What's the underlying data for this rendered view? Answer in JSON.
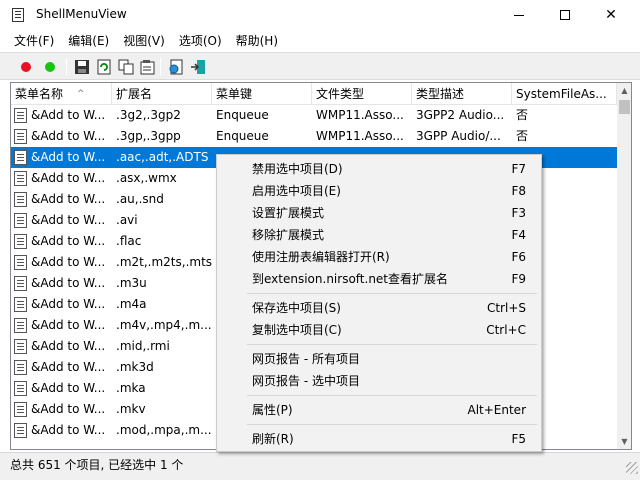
{
  "window": {
    "title": "ShellMenuView"
  },
  "menubar": [
    "文件(F)",
    "编辑(E)",
    "视图(V)",
    "选项(O)",
    "帮助(H)"
  ],
  "toolbar": {
    "colors": {
      "red": "#e81123",
      "green": "#16c60c"
    },
    "icons": [
      "red-dot-icon",
      "green-dot-icon",
      "save-icon",
      "refresh-icon",
      "copy-icon",
      "properties-icon",
      "html-report-icon",
      "exit-icon"
    ]
  },
  "list": {
    "columns": [
      "菜单名称",
      "扩展名",
      "菜单键",
      "文件类型",
      "类型描述",
      "SystemFileAs..."
    ],
    "sort_indicator": "^",
    "rows": [
      [
        "&Add to W...",
        ".3g2,.3gp2",
        "Enqueue",
        "WMP11.Asso...",
        "3GPP2 Audio...",
        "否"
      ],
      [
        "&Add to W...",
        ".3gp,.3gpp",
        "Enqueue",
        "WMP11.Asso...",
        "3GPP Audio/...",
        "否"
      ],
      [
        "&Add to W...",
        ".aac,.adt,.ADTS",
        "",
        "",
        "",
        ""
      ],
      [
        "&Add to W...",
        ".asx,.wmx",
        "",
        "",
        "",
        ""
      ],
      [
        "&Add to W...",
        ".au,.snd",
        "",
        "",
        "",
        ""
      ],
      [
        "&Add to W...",
        ".avi",
        "",
        "",
        "",
        ""
      ],
      [
        "&Add to W...",
        ".flac",
        "",
        "",
        "",
        ""
      ],
      [
        "&Add to W...",
        ".m2t,.m2ts,.mts",
        "",
        "",
        "",
        ""
      ],
      [
        "&Add to W...",
        ".m3u",
        "",
        "",
        "",
        ""
      ],
      [
        "&Add to W...",
        ".m4a",
        "",
        "",
        "",
        ""
      ],
      [
        "&Add to W...",
        ".m4v,.mp4,.m...",
        "",
        "",
        "",
        ""
      ],
      [
        "&Add to W...",
        ".mid,.rmi",
        "",
        "",
        "",
        ""
      ],
      [
        "&Add to W...",
        ".mk3d",
        "",
        "",
        "",
        ""
      ],
      [
        "&Add to W...",
        ".mka",
        "",
        "",
        "",
        ""
      ],
      [
        "&Add to W...",
        ".mkv",
        "",
        "",
        "",
        ""
      ],
      [
        "&Add to W...",
        ".mod,.mpa,.m...",
        "",
        "",
        "",
        ""
      ]
    ],
    "selected_index": 2,
    "selection_color": "#0078d7"
  },
  "context_menu": {
    "groups": [
      [
        {
          "label": "禁用选中项目(D)",
          "key": "F7"
        },
        {
          "label": "启用选中项目(E)",
          "key": "F8"
        },
        {
          "label": "设置扩展模式",
          "key": "F3"
        },
        {
          "label": "移除扩展模式",
          "key": "F4"
        },
        {
          "label": "使用注册表编辑器打开(R)",
          "key": "F6"
        },
        {
          "label": "到extension.nirsoft.net查看扩展名",
          "key": "F9"
        }
      ],
      [
        {
          "label": "保存选中项目(S)",
          "key": "Ctrl+S"
        },
        {
          "label": "复制选中项目(C)",
          "key": "Ctrl+C"
        }
      ],
      [
        {
          "label": "网页报告 - 所有项目",
          "key": ""
        },
        {
          "label": "网页报告 - 选中项目",
          "key": ""
        }
      ],
      [
        {
          "label": "属性(P)",
          "key": "Alt+Enter"
        }
      ],
      [
        {
          "label": "刷新(R)",
          "key": "F5"
        }
      ]
    ]
  },
  "statusbar": {
    "text": "总共 651 个项目, 已经选中 1 个"
  }
}
